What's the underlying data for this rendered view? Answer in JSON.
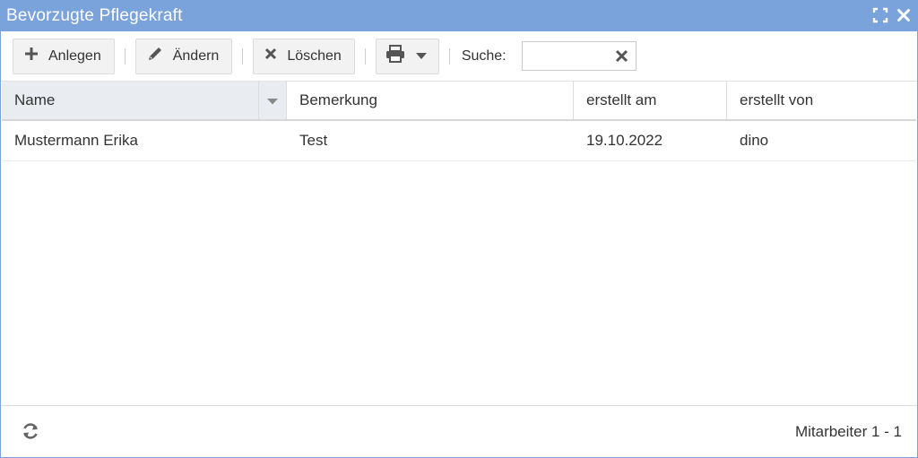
{
  "window": {
    "title": "Bevorzugte Pflegekraft"
  },
  "toolbar": {
    "add_label": "Anlegen",
    "edit_label": "Ändern",
    "delete_label": "Löschen",
    "search_label": "Suche:",
    "search_value": "",
    "search_placeholder": ""
  },
  "grid": {
    "columns": [
      "Name",
      "Bemerkung",
      "erstellt am",
      "erstellt von"
    ],
    "rows": [
      [
        "Mustermann Erika",
        "Test",
        "19.10.2022",
        "dino"
      ]
    ]
  },
  "footer": {
    "pager_text": "Mitarbeiter 1 - 1"
  },
  "colors": {
    "titlebar": "#7aa3dc",
    "icon_gray": "#555555"
  }
}
